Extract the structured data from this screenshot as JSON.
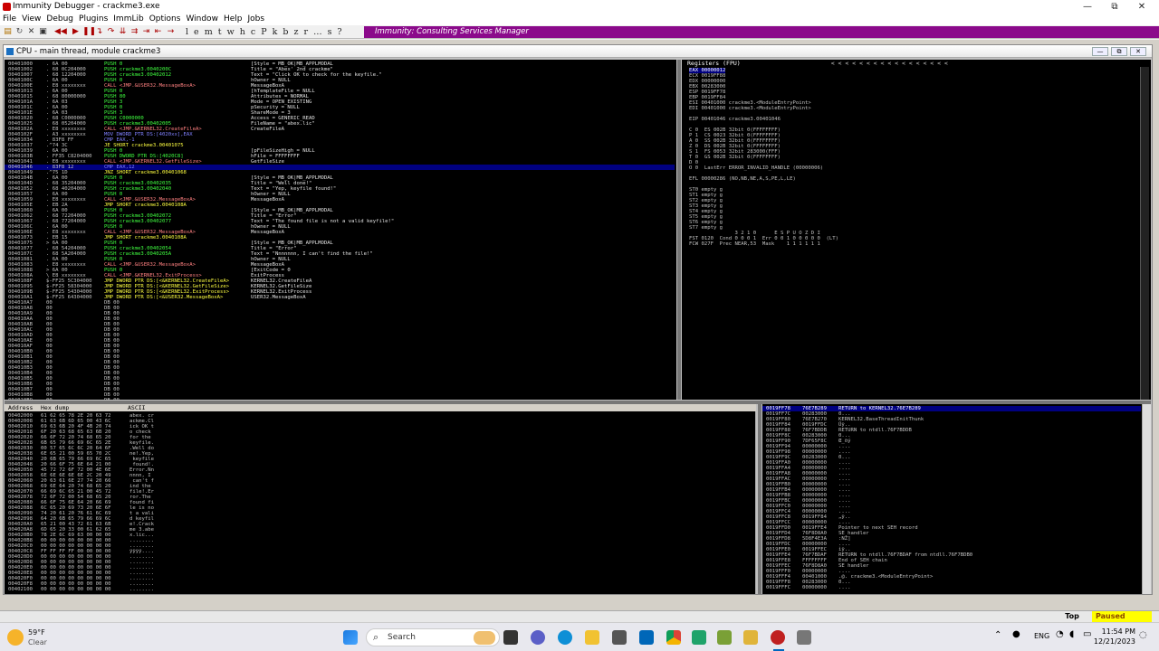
{
  "window": {
    "title": "Immunity Debugger - crackme3.exe",
    "minimize_glyph": "—",
    "restore_glyph": "⧉",
    "close_glyph": "✕"
  },
  "menu": [
    "File",
    "View",
    "Debug",
    "Plugins",
    "ImmLib",
    "Options",
    "Window",
    "Help",
    "Jobs"
  ],
  "toolbar": {
    "letters": "l e m t w h c P k b z r … s ?",
    "consulting": "Immunity: Consulting Services Manager"
  },
  "cpu_window": {
    "title": "CPU - main thread, module crackme3"
  },
  "disasm": {
    "rows": [
      {
        "addr": "00401000",
        "hex": ". 6A 00",
        "instr": "PUSH 0",
        "cmt": "[Style = MB_OK|MB_APPLMODAL"
      },
      {
        "addr": "00401002",
        "hex": ". 68 0C204000",
        "instr": "PUSH crackme3.0040200C",
        "cmt": "Title = \"Abex' 2nd crackme\""
      },
      {
        "addr": "00401007",
        "hex": ". 68 12204000",
        "instr": "PUSH crackme3.00402012",
        "cmt": "Text = \"Click OK to check for the keyfile.\""
      },
      {
        "addr": "0040100C",
        "hex": ". 6A 00",
        "instr": "PUSH 0",
        "cmt": "hOwner = NULL"
      },
      {
        "addr": "0040100E",
        "hex": ". E8 xxxxxxxx",
        "instr": "CALL <JMP.&USER32.MessageBoxA>",
        "cmt": "MessageBoxA"
      },
      {
        "addr": "00401013",
        "hex": ". 6A 00",
        "instr": "PUSH 0",
        "cmt": "[hTemplateFile = NULL"
      },
      {
        "addr": "00401015",
        "hex": ". 68 80000000",
        "instr": "PUSH 80",
        "cmt": "Attributes = NORMAL"
      },
      {
        "addr": "0040101A",
        "hex": ". 6A 03",
        "instr": "PUSH 3",
        "cmt": "Mode = OPEN_EXISTING"
      },
      {
        "addr": "0040101C",
        "hex": ". 6A 00",
        "instr": "PUSH 0",
        "cmt": "pSecurity = NULL"
      },
      {
        "addr": "0040101E",
        "hex": ". 6A 03",
        "instr": "PUSH 3",
        "cmt": "ShareMode = 3"
      },
      {
        "addr": "00401020",
        "hex": ". 68 C0000000",
        "instr": "PUSH C0000000",
        "cmt": "Access = GENERIC_READ"
      },
      {
        "addr": "00401025",
        "hex": ". 68 05204000",
        "instr": "PUSH crackme3.00402005",
        "cmt": "FileName = \"abex.lic\""
      },
      {
        "addr": "0040102A",
        "hex": ". E8 xxxxxxxx",
        "instr": "CALL <JMP.&KERNEL32.CreateFileA>",
        "cmt": "CreateFileA"
      },
      {
        "addr": "0040102F",
        "hex": ". A3 xxxxxxxx",
        "instr": "MOV DWORD PTR DS:[4020xx],EAX",
        "cmt": ""
      },
      {
        "addr": "00401034",
        "hex": ". 83F8 FF",
        "instr": "CMP EAX,-1",
        "cmt": ""
      },
      {
        "addr": "00401037",
        "hex": ".^74 3C",
        "instr": "JE SHORT crackme3.00401075",
        "cmt": ""
      },
      {
        "addr": "00401039",
        "hex": ". 6A 00",
        "instr": "PUSH 0",
        "cmt": "[pFileSizeHigh = NULL"
      },
      {
        "addr": "0040103B",
        "hex": ". FF35 C8204000",
        "instr": "PUSH DWORD PTR DS:[4020C8]",
        "cmt": "hFile = FFFFFFFF"
      },
      {
        "addr": "00401041",
        "hex": ". E8 xxxxxxxx",
        "instr": "CALL <JMP.&KERNEL32.GetFileSize>",
        "cmt": "GetFileSize"
      },
      {
        "addr": "00401046",
        "hex": ". 83F8 12",
        "instr": "CMP EAX,12",
        "cmt": ""
      },
      {
        "addr": "00401049",
        "hex": ".^75 1D",
        "instr": "JNZ SHORT crackme3.00401068",
        "cmt": ""
      },
      {
        "addr": "0040104B",
        "hex": ". 6A 00",
        "instr": "PUSH 0",
        "cmt": "[Style = MB_OK|MB_APPLMODAL"
      },
      {
        "addr": "0040104D",
        "hex": ". 68 35204000",
        "instr": "PUSH crackme3.00402035",
        "cmt": "Title = \"Well done!\""
      },
      {
        "addr": "00401052",
        "hex": ". 68 40204000",
        "instr": "PUSH crackme3.00402040",
        "cmt": "Text = \"Yep, keyfile found!\""
      },
      {
        "addr": "00401057",
        "hex": ". 6A 00",
        "instr": "PUSH 0",
        "cmt": "hOwner = NULL"
      },
      {
        "addr": "00401059",
        "hex": ". E8 xxxxxxxx",
        "instr": "CALL <JMP.&USER32.MessageBoxA>",
        "cmt": "MessageBoxA"
      },
      {
        "addr": "0040105E",
        "hex": ". EB 2A",
        "instr": "JMP SHORT crackme3.0040108A",
        "cmt": ""
      },
      {
        "addr": "00401060",
        "hex": ". 6A 00",
        "instr": "PUSH 0",
        "cmt": "[Style = MB_OK|MB_APPLMODAL"
      },
      {
        "addr": "00401062",
        "hex": ". 68 72204000",
        "instr": "PUSH crackme3.00402072",
        "cmt": "Title = \"Error\""
      },
      {
        "addr": "00401067",
        "hex": ". 68 77204000",
        "instr": "PUSH crackme3.00402077",
        "cmt": "Text = \"The found file is not a valid keyfile!\""
      },
      {
        "addr": "0040106C",
        "hex": ". 6A 00",
        "instr": "PUSH 0",
        "cmt": "hOwner = NULL"
      },
      {
        "addr": "0040106E",
        "hex": ". E8 xxxxxxxx",
        "instr": "CALL <JMP.&USER32.MessageBoxA>",
        "cmt": "MessageBoxA"
      },
      {
        "addr": "00401073",
        "hex": ". EB 15",
        "instr": "JMP SHORT crackme3.0040108A",
        "cmt": ""
      },
      {
        "addr": "00401075",
        "hex": "> 6A 00",
        "instr": "PUSH 0",
        "cmt": "[Style = MB_OK|MB_APPLMODAL"
      },
      {
        "addr": "00401077",
        "hex": ". 68 54204000",
        "instr": "PUSH crackme3.00402054",
        "cmt": "Title = \"Error\""
      },
      {
        "addr": "0040107C",
        "hex": ". 68 5A204000",
        "instr": "PUSH crackme3.0040205A",
        "cmt": "Text = \"Nnnnnnn, I can't find the file!\""
      },
      {
        "addr": "00401081",
        "hex": ". 6A 00",
        "instr": "PUSH 0",
        "cmt": "hOwner = NULL"
      },
      {
        "addr": "00401083",
        "hex": ". E8 xxxxxxxx",
        "instr": "CALL <JMP.&USER32.MessageBoxA>",
        "cmt": "MessageBoxA"
      },
      {
        "addr": "00401088",
        "hex": "> 6A 00",
        "instr": "PUSH 0",
        "cmt": "[ExitCode = 0"
      },
      {
        "addr": "0040108A",
        "hex": "\\ E8 xxxxxxxx",
        "instr": "CALL <JMP.&KERNEL32.ExitProcess>",
        "cmt": "ExitProcess"
      },
      {
        "addr": "0040108F",
        "hex": "$-FF25 5C304000",
        "instr": "JMP DWORD PTR DS:[<&KERNEL32.CreateFileA>",
        "cmt": "KERNEL32.CreateFileA"
      },
      {
        "addr": "00401095",
        "hex": "$-FF25 58304000",
        "instr": "JMP DWORD PTR DS:[<&KERNEL32.GetFileSize>",
        "cmt": "KERNEL32.GetFileSize"
      },
      {
        "addr": "0040109B",
        "hex": "$-FF25 54304000",
        "instr": "JMP DWORD PTR DS:[<&KERNEL32.ExitProcess>",
        "cmt": "KERNEL32.ExitProcess"
      },
      {
        "addr": "004010A1",
        "hex": "$-FF25 64304000",
        "instr": "JMP DWORD PTR DS:[<&USER32.MessageBoxA>",
        "cmt": "USER32.MessageBoxA"
      },
      {
        "addr": "004010A7",
        "hex": "00",
        "instr": "DB 00",
        "cmt": ""
      },
      {
        "addr": "004010A8",
        "hex": "00",
        "instr": "DB 00",
        "cmt": ""
      },
      {
        "addr": "004010A9",
        "hex": "00",
        "instr": "DB 00",
        "cmt": ""
      },
      {
        "addr": "004010AA",
        "hex": "00",
        "instr": "DB 00",
        "cmt": ""
      },
      {
        "addr": "004010AB",
        "hex": "00",
        "instr": "DB 00",
        "cmt": ""
      },
      {
        "addr": "004010AC",
        "hex": "00",
        "instr": "DB 00",
        "cmt": ""
      },
      {
        "addr": "004010AD",
        "hex": "00",
        "instr": "DB 00",
        "cmt": ""
      },
      {
        "addr": "004010AE",
        "hex": "00",
        "instr": "DB 00",
        "cmt": ""
      },
      {
        "addr": "004010AF",
        "hex": "00",
        "instr": "DB 00",
        "cmt": ""
      },
      {
        "addr": "004010B0",
        "hex": "00",
        "instr": "DB 00",
        "cmt": ""
      },
      {
        "addr": "004010B1",
        "hex": "00",
        "instr": "DB 00",
        "cmt": ""
      },
      {
        "addr": "004010B2",
        "hex": "00",
        "instr": "DB 00",
        "cmt": ""
      },
      {
        "addr": "004010B3",
        "hex": "00",
        "instr": "DB 00",
        "cmt": ""
      },
      {
        "addr": "004010B4",
        "hex": "00",
        "instr": "DB 00",
        "cmt": ""
      },
      {
        "addr": "004010B5",
        "hex": "00",
        "instr": "DB 00",
        "cmt": ""
      },
      {
        "addr": "004010B6",
        "hex": "00",
        "instr": "DB 00",
        "cmt": ""
      },
      {
        "addr": "004010B7",
        "hex": "00",
        "instr": "DB 00",
        "cmt": ""
      },
      {
        "addr": "004010B8",
        "hex": "00",
        "instr": "DB 00",
        "cmt": ""
      },
      {
        "addr": "004010B9",
        "hex": "00",
        "instr": "DB 00",
        "cmt": ""
      },
      {
        "addr": "004010BA",
        "hex": "00",
        "instr": "DB 00",
        "cmt": ""
      },
      {
        "addr": "004010BB",
        "hex": "00",
        "instr": "DB 00",
        "cmt": ""
      },
      {
        "addr": "004010BC",
        "hex": "00",
        "instr": "DB 00",
        "cmt": ""
      },
      {
        "addr": "004010BD",
        "hex": "00",
        "instr": "DB 00",
        "cmt": ""
      },
      {
        "addr": "004010BE",
        "hex": "00",
        "instr": "DB 00",
        "cmt": ""
      }
    ],
    "eip_row": 19
  },
  "registers": {
    "header": "Registers (FPU)",
    "arrows": "<  <  <  <  <  <  <  <  <  <  <  <  <  <  <  <  <",
    "lines": [
      "EAX 00000012",
      "ECX 0019FF88",
      "EDX 00000000",
      "EBX 00283000",
      "ESP 0019FF78",
      "EBP 0019FF84",
      "ESI 00401000 crackme3.<ModuleEntryPoint>",
      "EDI 00401000 crackme3.<ModuleEntryPoint>",
      "",
      "EIP 00401046 crackme3.00401046",
      "",
      "C 0  ES 002B 32bit 0(FFFFFFFF)",
      "P 1  CS 0023 32bit 0(FFFFFFFF)",
      "A 0  SS 002B 32bit 0(FFFFFFFF)",
      "Z 0  DS 002B 32bit 0(FFFFFFFF)",
      "S 1  FS 0053 32bit 283000(FFF)",
      "T 0  GS 002B 32bit 0(FFFFFFFF)",
      "D 0",
      "O 0  LastErr ERROR_INVALID_HANDLE (00000006)",
      "",
      "EFL 00000286 (NO,NB,NE,A,S,PE,L,LE)",
      "",
      "ST0 empty g",
      "ST1 empty g",
      "ST2 empty g",
      "ST3 empty g",
      "ST4 empty g",
      "ST5 empty g",
      "ST6 empty g",
      "ST7 empty g",
      "               3 2 1 0      E S P U O Z D I",
      "FST 0120  Cond 0 0 0 1  Err 0 0 1 0 0 0 0 0  (LT)",
      "FCW 027F  Prec NEAR,53  Mask    1 1 1 1 1 1"
    ]
  },
  "dump": {
    "header_addr": "Address",
    "header_hex": "Hex dump",
    "header_ascii": "ASCII",
    "rows": [
      [
        "00402000",
        "61 62 65 78 2E 20 63 72",
        "abex. cr"
      ],
      [
        "00402008",
        "61 63 6B 6D 65 00 43 6C",
        "ackme.Cl"
      ],
      [
        "00402010",
        "69 63 6B 20 4F 4B 20 74",
        "ick OK t"
      ],
      [
        "00402018",
        "6F 20 63 68 65 63 6B 20",
        "o check "
      ],
      [
        "00402020",
        "66 6F 72 20 74 68 65 20",
        "for the "
      ],
      [
        "00402028",
        "6B 65 79 66 69 6C 65 2E",
        "keyfile."
      ],
      [
        "00402030",
        "00 57 65 6C 6C 20 64 6F",
        ".Well do"
      ],
      [
        "00402038",
        "6E 65 21 00 59 65 70 2C",
        "ne!.Yep,"
      ],
      [
        "00402040",
        "20 6B 65 79 66 69 6C 65",
        " keyfile"
      ],
      [
        "00402048",
        "20 66 6F 75 6E 64 21 00",
        " found!."
      ],
      [
        "00402050",
        "45 72 72 6F 72 00 4E 6E",
        "Error.Nn"
      ],
      [
        "00402058",
        "6E 6E 6E 6E 6E 2C 20 49",
        "nnnn, I"
      ],
      [
        "00402060",
        "20 63 61 6E 27 74 20 66",
        " can't f"
      ],
      [
        "00402068",
        "69 6E 64 20 74 68 65 20",
        "ind the "
      ],
      [
        "00402070",
        "66 69 6C 65 21 00 45 72",
        "file!.Er"
      ],
      [
        "00402078",
        "72 6F 72 00 54 68 65 20",
        "ror.The "
      ],
      [
        "00402080",
        "66 6F 75 6E 64 20 66 69",
        "found fi"
      ],
      [
        "00402088",
        "6C 65 20 69 73 20 6E 6F",
        "le is no"
      ],
      [
        "00402090",
        "74 20 61 20 76 61 6C 69",
        "t a vali"
      ],
      [
        "00402098",
        "64 20 6B 65 79 66 69 6C",
        "d keyfil"
      ],
      [
        "004020A0",
        "65 21 00 43 72 61 63 6B",
        "e!.Crack"
      ],
      [
        "004020A8",
        "6D 65 20 33 00 61 62 65",
        "me 3.abe"
      ],
      [
        "004020B0",
        "78 2E 6C 69 63 00 00 00",
        "x.lic..."
      ],
      [
        "004020B8",
        "00 00 00 00 00 00 00 00",
        "........"
      ],
      [
        "004020C0",
        "00 00 00 00 00 00 00 00",
        "........"
      ],
      [
        "004020C8",
        "FF FF FF FF 00 00 00 00",
        "ÿÿÿÿ...."
      ],
      [
        "004020D0",
        "00 00 00 00 00 00 00 00",
        "........"
      ],
      [
        "004020D8",
        "00 00 00 00 00 00 00 00",
        "........"
      ],
      [
        "004020E0",
        "00 00 00 00 00 00 00 00",
        "........"
      ],
      [
        "004020E8",
        "00 00 00 00 00 00 00 00",
        "........"
      ],
      [
        "004020F0",
        "00 00 00 00 00 00 00 00",
        "........"
      ],
      [
        "004020F8",
        "00 00 00 00 00 00 00 00",
        "........"
      ],
      [
        "00402100",
        "00 00 00 00 00 00 00 00",
        "........"
      ]
    ]
  },
  "stack": {
    "rows": [
      [
        "0019FF78",
        "76E7B289",
        "RETURN to KERNEL32.76E7B289"
      ],
      [
        "0019FF7C",
        "00283000",
        "0..."
      ],
      [
        "0019FF80",
        "76E7B270",
        "KERNEL32.BaseThreadInitThunk"
      ],
      [
        "0019FF84",
        "0019FFDC",
        "Üÿ.."
      ],
      [
        "0019FF88",
        "76F7BDDB",
        "RETURN to ntdll.76F7BDDB"
      ],
      [
        "0019FF8C",
        "00283000",
        "0..."
      ],
      [
        "0019FF90",
        "7DF65F8C",
        "Œ_öý"
      ],
      [
        "0019FF94",
        "00000000",
        "...."
      ],
      [
        "0019FF98",
        "00000000",
        "...."
      ],
      [
        "0019FF9C",
        "00283000",
        "0..."
      ],
      [
        "0019FFA0",
        "00000000",
        "...."
      ],
      [
        "0019FFA4",
        "00000000",
        "...."
      ],
      [
        "0019FFA8",
        "00000000",
        "...."
      ],
      [
        "0019FFAC",
        "00000000",
        "...."
      ],
      [
        "0019FFB0",
        "00000000",
        "...."
      ],
      [
        "0019FFB4",
        "00000000",
        "...."
      ],
      [
        "0019FFB8",
        "00000000",
        "...."
      ],
      [
        "0019FFBC",
        "00000000",
        "...."
      ],
      [
        "0019FFC0",
        "00000000",
        "...."
      ],
      [
        "0019FFC4",
        "00000000",
        "...."
      ],
      [
        "0019FFC8",
        "0019FF84",
        "„ÿ.."
      ],
      [
        "0019FFCC",
        "00000000",
        "...."
      ],
      [
        "0019FFD0",
        "0019FFE4",
        "Pointer to next SEH record"
      ],
      [
        "0019FFD4",
        "76F8D8A0",
        "SE handler"
      ],
      [
        "0019FFD8",
        "5D8F4E3A",
        ":NŽ]"
      ],
      [
        "0019FFDC",
        "00000000",
        "...."
      ],
      [
        "0019FFE0",
        "0019FFEC",
        "ìÿ.."
      ],
      [
        "0019FFE4",
        "76F7BDAF",
        "RETURN to ntdll.76F7BDAF from ntdll.76F7BDB0"
      ],
      [
        "0019FFE8",
        "FFFFFFFF",
        "End of SEH chain"
      ],
      [
        "0019FFEC",
        "76F8D8A0",
        "SE handler"
      ],
      [
        "0019FFF0",
        "00000000",
        "...."
      ],
      [
        "0019FFF4",
        "00401000",
        ".@. crackme3.<ModuleEntryPoint>"
      ],
      [
        "0019FFF8",
        "00283000",
        "0..."
      ],
      [
        "0019FFFC",
        "00000000",
        "...."
      ]
    ]
  },
  "status": {
    "top_label": "Top",
    "paused_label": "Paused",
    "paused_color": "#ffff00"
  },
  "taskbar": {
    "weather_temp": "59°F",
    "weather_desc": "Clear",
    "search_placeholder": "Search",
    "lang": "ENG",
    "time": "11:54 PM",
    "date": "12/21/2023"
  }
}
